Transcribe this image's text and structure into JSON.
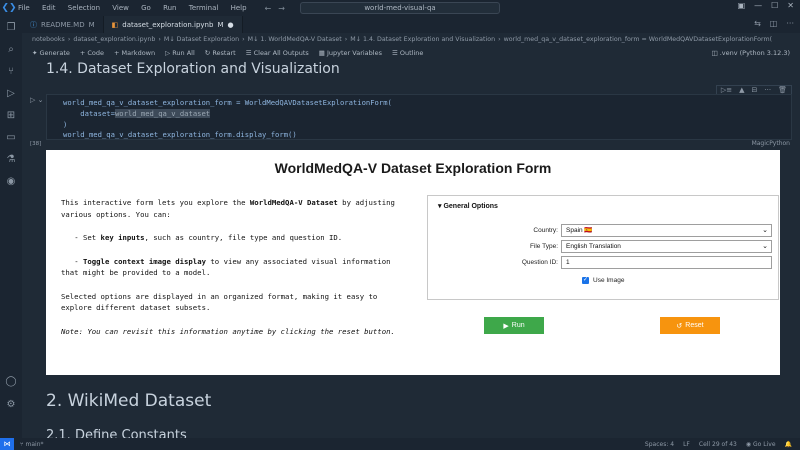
{
  "window": {
    "menu": [
      "File",
      "Edit",
      "Selection",
      "View",
      "Go",
      "Run",
      "Terminal",
      "Help"
    ],
    "search": "world-med-visual-qa"
  },
  "tabs": [
    {
      "label": "README.MD",
      "modified_mark": "M"
    },
    {
      "label": "dataset_exploration.ipynb",
      "modified_mark": "M"
    }
  ],
  "breadcrumb": [
    "notebooks",
    "dataset_exploration.ipynb",
    "M↓ Dataset Exploration",
    "M↓ 1. WorldMedQA-V Dataset",
    "M↓ 1.4. Dataset Exploration and Visualization",
    "world_med_qa_v_dataset_exploration_form = WorldMedQAVDatasetExplorationForm("
  ],
  "toolbar": {
    "generate": "Generate",
    "code": "+ Code",
    "markdown": "+ Markdown",
    "run_all": "Run All",
    "restart": "Restart",
    "clear": "Clear All Outputs",
    "variables": "Jupyter Variables",
    "outline": "Outline",
    "kernel": ".venv (Python 3.12.3)"
  },
  "section_heading": "1.4. Dataset Exploration and Visualization",
  "cell": {
    "line1": "world_med_qa_v_dataset_exploration_form = WorldMedQAVDatasetExplorationForm(",
    "line2_prefix": "    dataset=",
    "line2_hl": "world_med_qa_v_dataset",
    "line3": ")",
    "line4": "world_med_qa_v_dataset_exploration_form.display_form()",
    "exec_count": "[38]",
    "language": "MagicPython"
  },
  "form": {
    "title": "WorldMedQA-V Dataset Exploration Form",
    "intro_a": "This interactive form lets you explore the ",
    "intro_b": "WorldMedQA-V Dataset",
    "intro_c": " by adjusting various options. You can:",
    "bullet1_a": "- Set ",
    "bullet1_b": "key inputs",
    "bullet1_c": ", such as country, file type and question ID.",
    "bullet2_a": "- ",
    "bullet2_b": "Toggle context image display",
    "bullet2_c": " to view any associated visual information that might be provided to a model.",
    "para3": "Selected options are displayed in an organized format, making it easy to explore different dataset subsets.",
    "note": "Note: You can revisit this information anytime by clicking the reset button.",
    "panel_title": "General Options",
    "country_label": "Country:",
    "country_value": "Spain 🇪🇸",
    "filetype_label": "File Type:",
    "filetype_value": "English Translation",
    "qid_label": "Question ID:",
    "qid_value": "1",
    "image_label": "Use Image",
    "run_label": "Run",
    "reset_label": "Reset"
  },
  "headings": {
    "h2": "2. WikiMed Dataset",
    "h3": "2.1. Define Constants"
  },
  "statusbar": {
    "branch": "main*",
    "spaces": "Spaces: 4",
    "eol": "LF",
    "cell": "Cell 29 of 43",
    "golive": "Go Live"
  },
  "colors": {
    "run": "#3ea84a",
    "reset": "#f7940e",
    "accent": "#1f6feb"
  }
}
